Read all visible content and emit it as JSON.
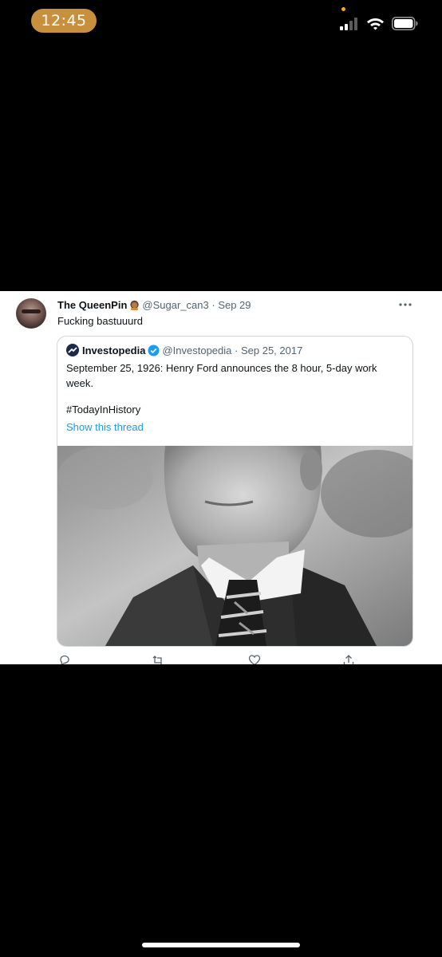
{
  "status_bar": {
    "time": "12:45",
    "pill_color": "#c8903d",
    "icons": [
      "cellular-signal-icon",
      "wifi-icon",
      "battery-icon"
    ]
  },
  "tweet": {
    "author_name": "The QueenPin",
    "author_handle": "@Sugar_can3",
    "separator": "·",
    "date": "Sep 29",
    "text": "Fucking bastuuurd",
    "quoted": {
      "author_name": "Investopedia",
      "author_handle": "@Investopedia",
      "separator": "·",
      "date": "Sep 25, 2017",
      "text": "September 25, 1926: Henry Ford announces the 8 hour, 5-day work week.",
      "hashtag": "#TodayInHistory",
      "thread_link": "Show this thread",
      "link_color": "#1d9bf0"
    },
    "actions": [
      "reply-icon",
      "retweet-icon",
      "like-icon",
      "share-icon"
    ]
  }
}
